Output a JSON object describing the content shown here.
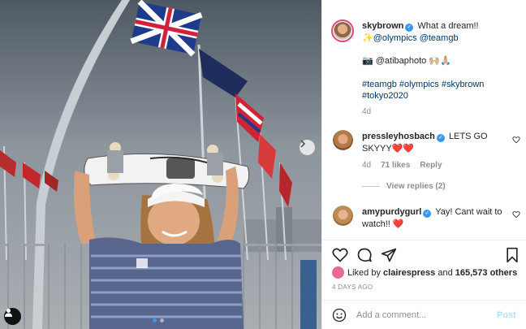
{
  "post": {
    "author": "skybrown",
    "caption_first": "What a dream!!",
    "caption_line2": "✨@olympics @teamgb",
    "caption_line3": "📷 @atibaphoto 🙌🏼🙏🏼",
    "hashtags_line1": "#teamgb #olympics #skybrown",
    "hashtags_line2": "#tokyo2020",
    "caption_age": "4d"
  },
  "comments": [
    {
      "user": "pressleyhosbach",
      "text": "LETS GO SKYYY❤️❤️",
      "age": "4d",
      "likes": "71 likes",
      "reply": "Reply",
      "view_replies": "View replies (2)"
    },
    {
      "user": "amypurdygurl",
      "text": "Yay! Cant wait to watch!! ❤️"
    }
  ],
  "likes": {
    "prefix": "Liked by",
    "by_user": "clairespress",
    "and": "and",
    "count_text": "165,573 others"
  },
  "timestamp": "4 DAYS AGO",
  "add_comment": {
    "placeholder": "Add a comment...",
    "post_label": "Post"
  },
  "icons": {
    "verified": "verified-badge-icon",
    "like": "heart-icon",
    "comment": "comment-icon",
    "share": "paper-plane-icon",
    "save": "bookmark-icon",
    "emoji": "smiley-icon",
    "next": "chevron-right-icon",
    "tag": "person-tag-icon"
  },
  "colors": {
    "accent": "#3897f0",
    "link": "#00376b",
    "meta": "#8e8e8e",
    "heart_red": "#ed4956",
    "post_disabled": "#b2dffc"
  }
}
